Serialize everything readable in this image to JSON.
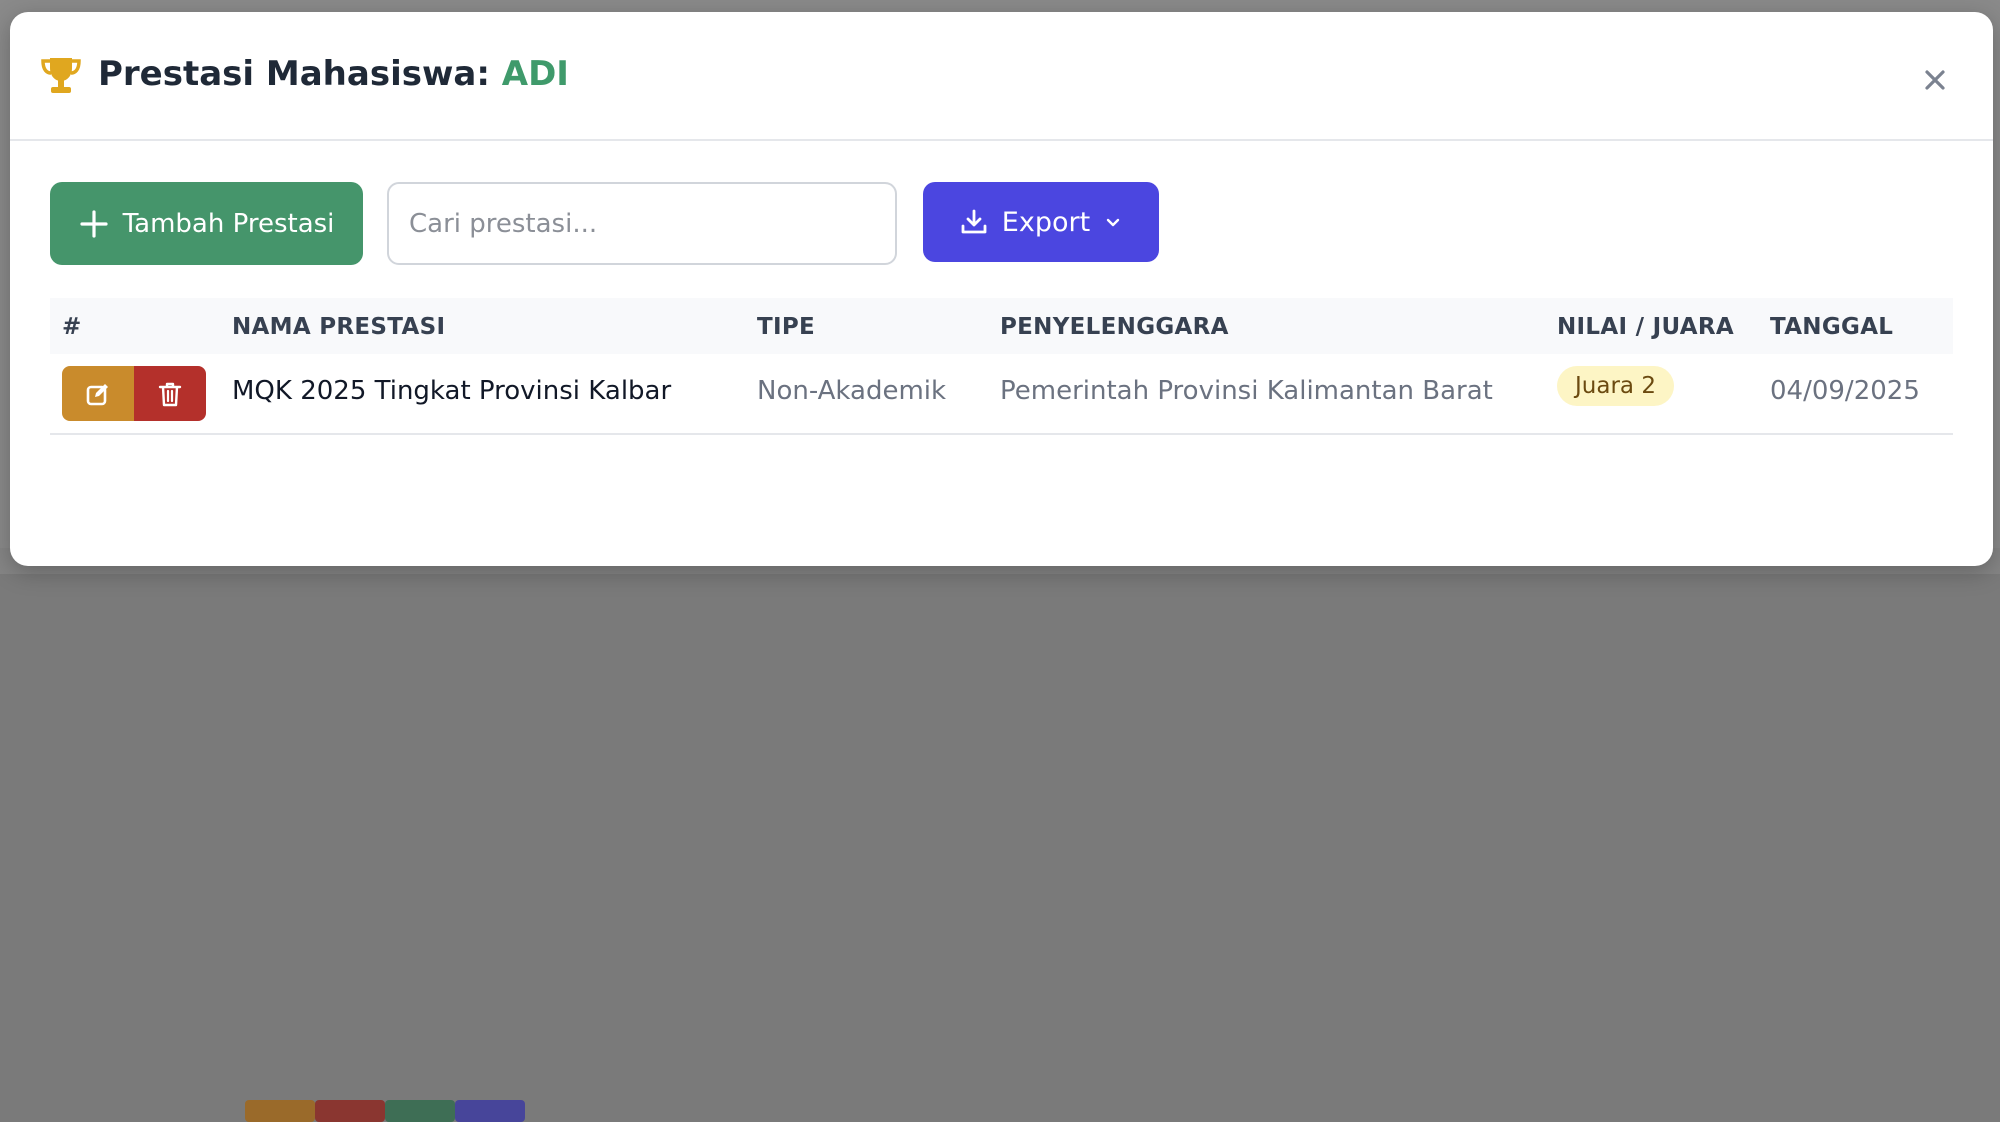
{
  "modal": {
    "title_prefix": "Prestasi Mahasiswa:",
    "title_name": "ADI",
    "icons": {
      "title": "trophy-icon",
      "close": "close-icon"
    }
  },
  "toolbar": {
    "add_label": "Tambah Prestasi",
    "search_placeholder": "Cari prestasi...",
    "search_value": "",
    "export_label": "Export"
  },
  "table": {
    "headers": [
      "#",
      "NAMA PRESTASI",
      "TIPE",
      "PENYELENGGARA",
      "NILAI / JUARA",
      "TANGGAL"
    ],
    "rows": [
      {
        "nama": "MQK 2025 Tingkat Provinsi Kalbar",
        "tipe": "Non-Akademik",
        "penyelenggara": "Pemerintah Provinsi Kalimantan Barat",
        "nilai": "Juara 2",
        "tanggal": "04/09/2025"
      }
    ]
  },
  "colors": {
    "accent_green": "#45956b",
    "export_indigo": "#4b46e0",
    "edit_amber": "#c98b2c",
    "delete_red": "#b4302b",
    "badge_bg": "#fdf5c5"
  }
}
